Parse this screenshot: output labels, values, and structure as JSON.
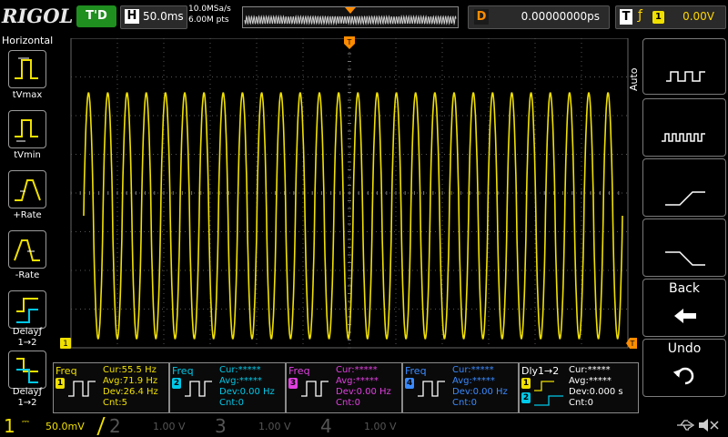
{
  "brand": "RIGOL",
  "status": "T'D",
  "horizontal": {
    "label": "H",
    "timebase": "50.0ms"
  },
  "sample": {
    "rate": "10.0MSa/s",
    "points": "6.00M pts"
  },
  "delay": {
    "label": "D",
    "value": "0.00000000ps"
  },
  "trigger": {
    "label": "T",
    "source": "1",
    "level": "0.00V"
  },
  "left_menu": {
    "title": "Horizontal",
    "items": [
      {
        "label": "tVmax",
        "icon": "tvmax-icon"
      },
      {
        "label": "tVmin",
        "icon": "tvmin-icon"
      },
      {
        "label": "+Rate",
        "icon": "rise-rate-icon"
      },
      {
        "label": "-Rate",
        "icon": "fall-rate-icon"
      },
      {
        "label": "Delayƒ",
        "sub": "1→2",
        "icon": "delay-rise-icon"
      },
      {
        "label": "Delayƒ",
        "sub": "1→2",
        "icon": "delay-fall-icon"
      }
    ]
  },
  "right_menu": {
    "auto_label": "Auto",
    "back_label": "Back",
    "undo_label": "Undo"
  },
  "markers": {
    "trigger_top": "T",
    "ch1": "1"
  },
  "measurements": [
    {
      "name": "Freq",
      "source": "1",
      "color": "#f0e000",
      "cur": "Cur:55.5 Hz",
      "avg": "Avg:71.9 Hz",
      "dev": "Dev:26.4 Hz",
      "cnt": "Cnt:5"
    },
    {
      "name": "Freq",
      "source": "2",
      "color": "#00c8e8",
      "cur": "Cur:*****",
      "avg": "Avg:*****",
      "dev": "Dev:0.00 Hz",
      "cnt": "Cnt:0"
    },
    {
      "name": "Freq",
      "source": "3",
      "color": "#e040e0",
      "cur": "Cur:*****",
      "avg": "Avg:*****",
      "dev": "Dev:0.00 Hz",
      "cnt": "Cnt:0"
    },
    {
      "name": "Freq",
      "source": "4",
      "color": "#3a8aff",
      "cur": "Cur:*****",
      "avg": "Avg:*****",
      "dev": "Dev:0.00 Hz",
      "cnt": "Cnt:0"
    },
    {
      "name": "Dly1→2",
      "source": "1",
      "source2": "2",
      "color": "#ffffff",
      "cur": "Cur:*****",
      "avg": "Avg:*****",
      "dev": "Dev:0.000 s",
      "cnt": "Cnt:0"
    }
  ],
  "channels": [
    {
      "num": "1",
      "scale": "50.0mV",
      "color": "#f0e000",
      "active": true
    },
    {
      "num": "2",
      "scale": "1.00 V",
      "color": "#555555",
      "active": false
    },
    {
      "num": "3",
      "scale": "1.00 V",
      "color": "#555555",
      "active": false
    },
    {
      "num": "4",
      "scale": "1.00 V",
      "color": "#555555",
      "active": false
    }
  ],
  "waveform": {
    "cycles": 28,
    "color": "#f0e000"
  }
}
